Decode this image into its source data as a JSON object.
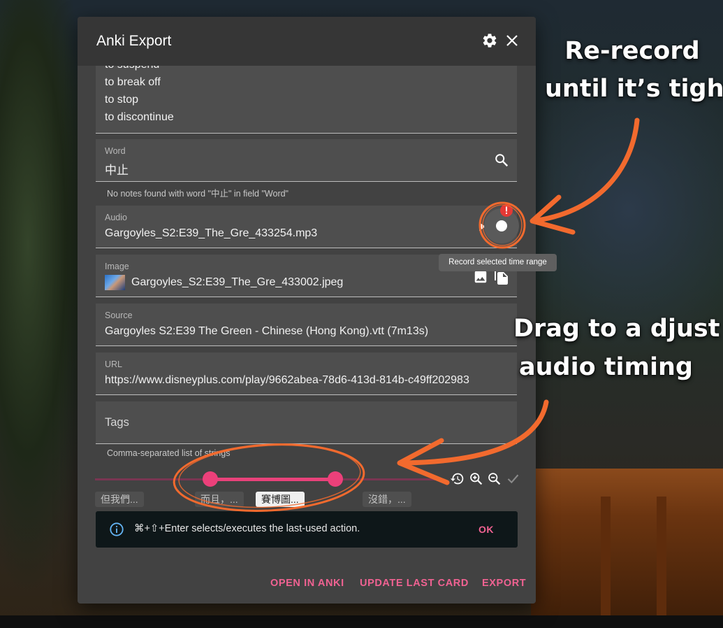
{
  "dialog": {
    "title": "Anki Export",
    "definitions": [
      "to suspend",
      "to break off",
      "to stop",
      "to discontinue"
    ],
    "word": {
      "label": "Word",
      "value": "中止",
      "hint": "No notes found with word \"中止\" in field \"Word\""
    },
    "audio": {
      "label": "Audio",
      "value": "Gargoyles_S2:E39_The_Gre_433254.mp3"
    },
    "record_tooltip": "Record selected time range",
    "image": {
      "label": "Image",
      "value": "Gargoyles_S2:E39_The_Gre_433002.jpeg"
    },
    "source": {
      "label": "Source",
      "value": "Gargoyles S2:E39 The Green - Chinese (Hong Kong).vtt (7m13s)"
    },
    "url": {
      "label": "URL",
      "value": "https://www.disneyplus.com/play/9662abea-78d6-413d-814b-c49ff202983"
    },
    "tags": {
      "placeholder": "Tags",
      "hint": "Comma-separated list of strings"
    },
    "timeline_chips": [
      "但我們...",
      "而且，...",
      "賽博圖...",
      "沒錯，..."
    ],
    "notice": {
      "text": "⌘+⇧+Enter selects/executes the last-used action.",
      "ok_label": "OK"
    },
    "actions": {
      "open_in_anki": "OPEN IN ANKI",
      "update_last_card": "UPDATE LAST CARD",
      "export": "EXPORT"
    }
  },
  "annotations": {
    "rerecord": [
      "Re-record",
      "until it’s tight"
    ],
    "drag": [
      "Drag to a djust",
      "audio timing"
    ]
  },
  "colors": {
    "accent": "#f06292",
    "annotation": "#f26a2e",
    "dialog_bg": "#424242",
    "field_bg": "#4e4e4e"
  },
  "icons": [
    "gear-icon",
    "close-icon",
    "search-icon",
    "play-icon",
    "record-icon",
    "alert-badge-icon",
    "image-icon",
    "copy-icon",
    "history-icon",
    "zoom-in-icon",
    "zoom-out-icon",
    "check-icon",
    "info-icon"
  ]
}
